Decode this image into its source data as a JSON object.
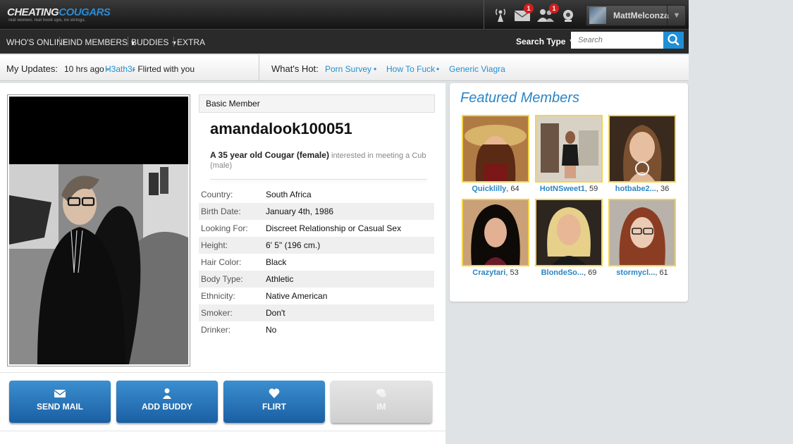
{
  "header": {
    "logo_part1": "CHEATING",
    "logo_part2": "COUGARS",
    "logo_tagline": "real women. real hook ups. no strings.",
    "icons": [
      {
        "name": "radio-tower-icon",
        "badge": ""
      },
      {
        "name": "mail-icon",
        "badge": "1"
      },
      {
        "name": "friends-icon",
        "badge": "1"
      },
      {
        "name": "webcam-icon",
        "badge": ""
      }
    ],
    "username": "MattMelconza"
  },
  "nav": {
    "items": [
      "WHO'S ONLINE",
      "FIND MEMBERS",
      "BUDDIES",
      "EXTRA"
    ],
    "search_type_label": "Search Type",
    "search_placeholder": "Search"
  },
  "updates": {
    "label": "My Updates:",
    "time": "10 hrs ago -",
    "user": "H3ath3r",
    "text": "- Flirted with you",
    "hot_label": "What's Hot:",
    "hot_links": [
      "Porn Survey",
      "How To Fuck",
      "Generic Viagra"
    ]
  },
  "profile": {
    "member_type": "Basic Member",
    "name": "amandalook100051",
    "tagline_strong": "A 35 year old Cougar (female)",
    "tagline_rest": "interested in meeting a Cub (male)",
    "details": [
      {
        "label": "Country:",
        "value": "South Africa"
      },
      {
        "label": "Birth Date:",
        "value": "January 4th, 1986"
      },
      {
        "label": "Looking For:",
        "value": "Discreet Relationship or Casual Sex"
      },
      {
        "label": "Height:",
        "value": "6' 5\" (196 cm.)"
      },
      {
        "label": "Hair Color:",
        "value": "Black"
      },
      {
        "label": "Body Type:",
        "value": "Athletic"
      },
      {
        "label": "Ethnicity:",
        "value": "Native American"
      },
      {
        "label": "Smoker:",
        "value": "Don't"
      },
      {
        "label": "Drinker:",
        "value": "No"
      }
    ]
  },
  "actions": [
    {
      "label": "SEND MAIL",
      "icon": "mail-icon",
      "enabled": true
    },
    {
      "label": "ADD BUDDY",
      "icon": "person-icon",
      "enabled": true
    },
    {
      "label": "FLIRT",
      "icon": "heart-icon",
      "enabled": true
    },
    {
      "label": "IM",
      "icon": "chat-icon",
      "enabled": false
    }
  ],
  "featured": {
    "title": "Featured Members",
    "members": [
      {
        "name": "Quicklilly",
        "age": ", 64"
      },
      {
        "name": "HotNSweet1",
        "age": ", 59"
      },
      {
        "name": "hotbabe2...",
        "age": ", 36"
      },
      {
        "name": "Crazytari",
        "age": ", 53"
      },
      {
        "name": "BlondeSo...",
        "age": ", 69"
      },
      {
        "name": "stormycl...",
        "age": ", 61"
      }
    ]
  },
  "colors": {
    "accent": "#1f8fd6",
    "button_blue": "#1a5fa3",
    "thumb_border": "#f3d34a"
  }
}
